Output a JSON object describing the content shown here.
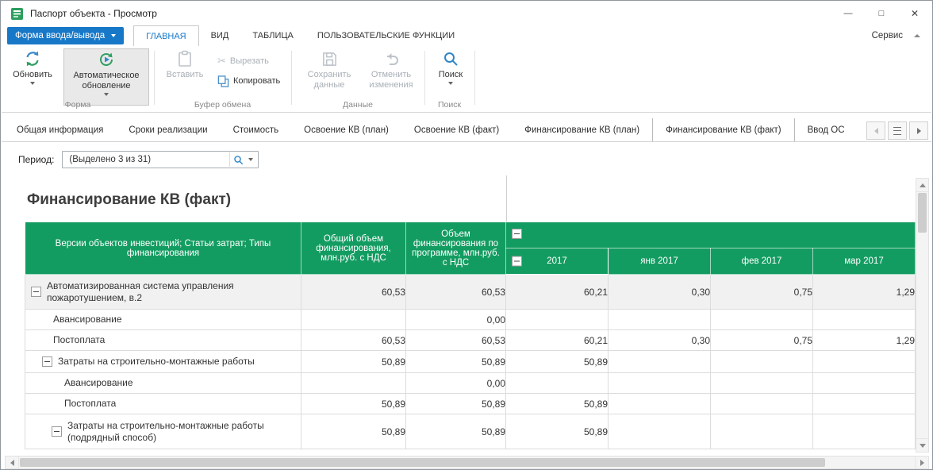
{
  "window": {
    "title": "Паспорт объекта - Просмотр",
    "minimize": "—",
    "maximize": "□",
    "close": "✕"
  },
  "menubar": {
    "io_button": "Форма ввода/вывода",
    "tabs": [
      "ГЛАВНАЯ",
      "ВИД",
      "ТАБЛИЦА",
      "ПОЛЬЗОВАТЕЛЬСКИЕ ФУНКЦИИ"
    ],
    "service": "Сервис"
  },
  "ribbon": {
    "refresh": "Обновить",
    "auto_refresh": "Автоматическое обновление",
    "paste": "Вставить",
    "cut": "Вырезать",
    "copy": "Копировать",
    "save": "Сохранить данные",
    "undo": "Отменить изменения",
    "search": "Поиск",
    "group_form": "Форма",
    "group_clipboard": "Буфер обмена",
    "group_data": "Данные",
    "group_search": "Поиск"
  },
  "doc_tabs": {
    "items": [
      "Общая информация",
      "Сроки реализации",
      "Стоимость",
      "Освоение КВ (план)",
      "Освоение КВ (факт)",
      "Финансирование КВ (план)",
      "Финансирование КВ (факт)",
      "Ввод ОС"
    ]
  },
  "filter": {
    "label": "Период:",
    "value": "(Выделено 3 из 31)"
  },
  "page": {
    "title": "Финансирование КВ (факт)"
  },
  "table": {
    "headers": {
      "col1": "Версии объектов инвестиций; Статьи затрат; Типы финансирования",
      "col2": "Общий объем финансирования, млн.руб. с НДС",
      "col3": "Объем финансирования по программе, млн.руб. с НДС",
      "year": "2017",
      "months": [
        "янв 2017",
        "фев 2017",
        "мар 2017"
      ]
    },
    "rows": [
      {
        "name": "Автоматизированная система управления пожаротушением, в.2",
        "values": [
          "60,53",
          "60,53",
          "60,21",
          "0,30",
          "0,75",
          "1,29"
        ]
      },
      {
        "name": "Авансирование",
        "values": [
          "",
          "0,00",
          "",
          "",
          "",
          ""
        ]
      },
      {
        "name": "Постоплата",
        "values": [
          "60,53",
          "60,53",
          "60,21",
          "0,30",
          "0,75",
          "1,29"
        ]
      },
      {
        "name": "Затраты на строительно-монтажные работы",
        "values": [
          "50,89",
          "50,89",
          "50,89",
          "",
          "",
          ""
        ]
      },
      {
        "name": "Авансирование",
        "values": [
          "",
          "0,00",
          "",
          "",
          "",
          ""
        ]
      },
      {
        "name": "Постоплата",
        "values": [
          "50,89",
          "50,89",
          "50,89",
          "",
          "",
          ""
        ]
      },
      {
        "name": "Затраты на строительно-монтажные работы (подрядный способ)",
        "values": [
          "50,89",
          "50,89",
          "50,89",
          "",
          "",
          ""
        ]
      }
    ]
  }
}
